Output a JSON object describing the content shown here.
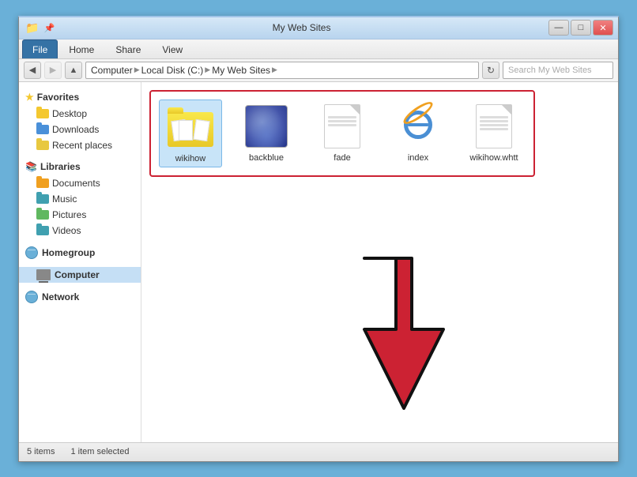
{
  "window": {
    "title": "My Web Sites",
    "titlebar_icon": "📁",
    "controls": {
      "minimize": "—",
      "maximize": "□",
      "close": "✕"
    }
  },
  "ribbon": {
    "tabs": [
      {
        "label": "File",
        "active": true
      },
      {
        "label": "Home",
        "active": false
      },
      {
        "label": "Share",
        "active": false
      },
      {
        "label": "View",
        "active": false
      }
    ]
  },
  "addressbar": {
    "back_tooltip": "Back",
    "forward_tooltip": "Forward",
    "up_tooltip": "Up",
    "path": {
      "parts": [
        "Computer",
        "Local Disk (C:)",
        "My Web Sites"
      ],
      "separator": "▶"
    },
    "search_placeholder": "Search My Web Sites",
    "refresh_label": "↻"
  },
  "sidebar": {
    "sections": [
      {
        "id": "favorites",
        "header": "Favorites",
        "icon": "⭐",
        "items": [
          {
            "label": "Desktop",
            "icon_class": "sf sf-yellow"
          },
          {
            "label": "Downloads",
            "icon_class": "sf sf-blue"
          },
          {
            "label": "Recent places",
            "icon_class": "sf sf-special"
          }
        ]
      },
      {
        "id": "libraries",
        "header": "Libraries",
        "icon": "📚",
        "items": [
          {
            "label": "Documents",
            "icon_class": "sf sf-orange"
          },
          {
            "label": "Music",
            "icon_class": "sf sf-teal"
          },
          {
            "label": "Pictures",
            "icon_class": "sf sf-green"
          },
          {
            "label": "Videos",
            "icon_class": "sf sf-teal"
          }
        ]
      },
      {
        "id": "homegroup",
        "header": "Homegroup",
        "icon": "🌐",
        "items": []
      },
      {
        "id": "computer",
        "header": "Computer",
        "icon": "💻",
        "items": [],
        "active": true
      },
      {
        "id": "network",
        "header": "Network",
        "icon": "🌐",
        "items": []
      }
    ]
  },
  "files": {
    "items": [
      {
        "id": "wikihow",
        "name": "wikihow",
        "type": "folder",
        "selected": true
      },
      {
        "id": "backblue",
        "name": "backblue",
        "type": "image"
      },
      {
        "id": "fade",
        "name": "fade",
        "type": "document"
      },
      {
        "id": "index",
        "name": "index",
        "type": "html"
      },
      {
        "id": "wikihow_whtt",
        "name": "wikihow.whtt",
        "type": "document"
      }
    ]
  },
  "statusbar": {
    "item_count": "5 items",
    "selected": "1 item selected"
  }
}
